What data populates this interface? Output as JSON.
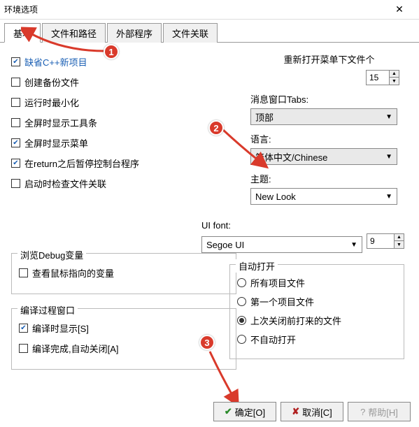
{
  "window": {
    "title": "环境选项"
  },
  "tabs": [
    "基本",
    "文件和路径",
    "外部程序",
    "文件关联"
  ],
  "active_tab": 0,
  "left_checks": [
    {
      "label": "缺省C++新项目",
      "checked": true
    },
    {
      "label": "创建备份文件",
      "checked": false
    },
    {
      "label": "运行时最小化",
      "checked": false
    },
    {
      "label": "全屏时显示工具条",
      "checked": false
    },
    {
      "label": "全屏时显示菜单",
      "checked": true
    },
    {
      "label": "在return之后暂停控制台程序",
      "checked": true
    },
    {
      "label": "启动时检查文件关联",
      "checked": false
    }
  ],
  "reopen": {
    "label": "重新打开菜单下文件个",
    "value": "15"
  },
  "tabs_pos": {
    "label": "消息窗口Tabs:",
    "value": "顶部"
  },
  "language": {
    "label": "语言:",
    "value": "简体中文/Chinese"
  },
  "theme": {
    "label": "主题:",
    "value": "New Look"
  },
  "ui_font": {
    "label": "UI font:",
    "value": "Segoe UI",
    "size": "9"
  },
  "debug_group": {
    "legend": "浏览Debug变量",
    "check": {
      "label": "查看鼠标指向的变量",
      "checked": false
    }
  },
  "compile_group": {
    "legend": "编译过程窗口",
    "checks": [
      {
        "label": "编译时显示[S]",
        "checked": true
      },
      {
        "label": "编译完成,自动关闭[A]",
        "checked": false
      }
    ]
  },
  "auto_open": {
    "legend": "自动打开",
    "options": [
      "所有项目文件",
      "第一个项目文件",
      "上次关闭前打来的文件",
      "不自动打开"
    ],
    "selected": 2
  },
  "buttons": {
    "ok": "确定[O]",
    "cancel": "取消[C]",
    "help": "帮助[H]"
  },
  "annotations": {
    "1": "1",
    "2": "2",
    "3": "3"
  }
}
